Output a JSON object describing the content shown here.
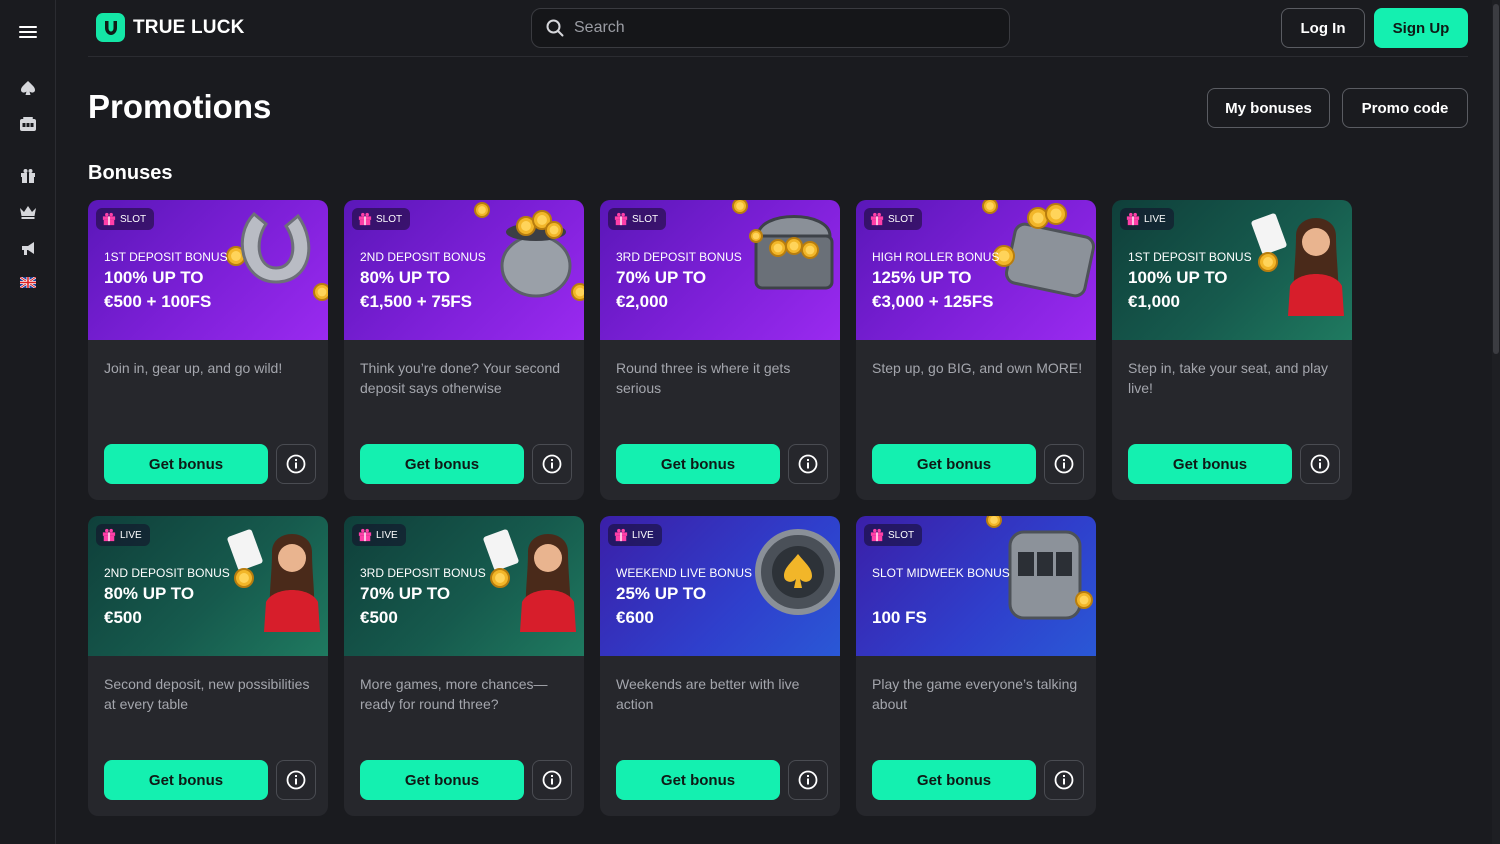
{
  "brand": {
    "name": "TRUE LUCK",
    "accent": "#14f0b0"
  },
  "sidebar": {
    "menu_icon": "hamburger-icon",
    "items": [
      {
        "icon": "spade-icon"
      },
      {
        "icon": "slot-machine-icon"
      },
      {
        "icon": "gift-icon"
      },
      {
        "icon": "crown-icon"
      },
      {
        "icon": "megaphone-icon"
      },
      {
        "icon": "uk-flag-icon"
      }
    ]
  },
  "header": {
    "search_placeholder": "Search",
    "login_label": "Log In",
    "signup_label": "Sign Up"
  },
  "page": {
    "title": "Promotions",
    "my_bonuses_label": "My bonuses",
    "promo_code_label": "Promo code",
    "section_title": "Bonuses"
  },
  "cards": [
    {
      "tag": "SLOT",
      "title": "1ST DEPOSIT BONUS",
      "line1": "100% UP TO",
      "line2": "€500 + 100FS",
      "desc": "Join in, gear up, and go wild!",
      "button": "Get bonus",
      "theme": "purple",
      "art": "horseshoe"
    },
    {
      "tag": "SLOT",
      "title": "2ND DEPOSIT BONUS",
      "line1": "80% UP TO",
      "line2": "€1,500 + 75FS",
      "desc": "Think you’re done? Your second deposit says otherwise",
      "button": "Get bonus",
      "theme": "purple",
      "art": "coin-pot"
    },
    {
      "tag": "SLOT",
      "title": "3RD DEPOSIT BONUS",
      "line1": "70% UP TO",
      "line2": "€2,000",
      "desc": "Round three is where it gets serious",
      "button": "Get bonus",
      "theme": "purple",
      "art": "treasure-chest"
    },
    {
      "tag": "SLOT",
      "title": "HIGH ROLLER BONUS",
      "line1": "125% UP TO",
      "line2": "€3,000 + 125FS",
      "desc": "Step up, go BIG, and own MORE!",
      "button": "Get bonus",
      "theme": "purple",
      "art": "wallet"
    },
    {
      "tag": "LIVE",
      "title": "1ST DEPOSIT BONUS",
      "line1": "100% UP TO",
      "line2": "€1,000",
      "desc": "Step in, take your seat, and play live!",
      "button": "Get bonus",
      "theme": "green",
      "art": "dealer"
    },
    {
      "tag": "LIVE",
      "title": "2ND DEPOSIT BONUS",
      "line1": "80% UP TO",
      "line2": "€500",
      "desc": "Second deposit, new possibilities at every table",
      "button": "Get bonus",
      "theme": "green",
      "art": "dealer"
    },
    {
      "tag": "LIVE",
      "title": "3RD DEPOSIT BONUS",
      "line1": "70% UP TO",
      "line2": "€500",
      "desc": "More games, more chances—ready for round three?",
      "button": "Get bonus",
      "theme": "green",
      "art": "dealer"
    },
    {
      "tag": "LIVE",
      "title": "WEEKEND LIVE BONUS",
      "line1": "25% UP TO",
      "line2": "€600",
      "desc": "Weekends are better with live action",
      "button": "Get bonus",
      "theme": "blue",
      "art": "chip"
    },
    {
      "tag": "SLOT",
      "title": "SLOT MIDWEEK BONUS",
      "line1": "",
      "line2": "100 FS",
      "desc": "Play the game everyone’s talking about",
      "button": "Get bonus",
      "theme": "blue",
      "art": "slot-machine"
    }
  ]
}
